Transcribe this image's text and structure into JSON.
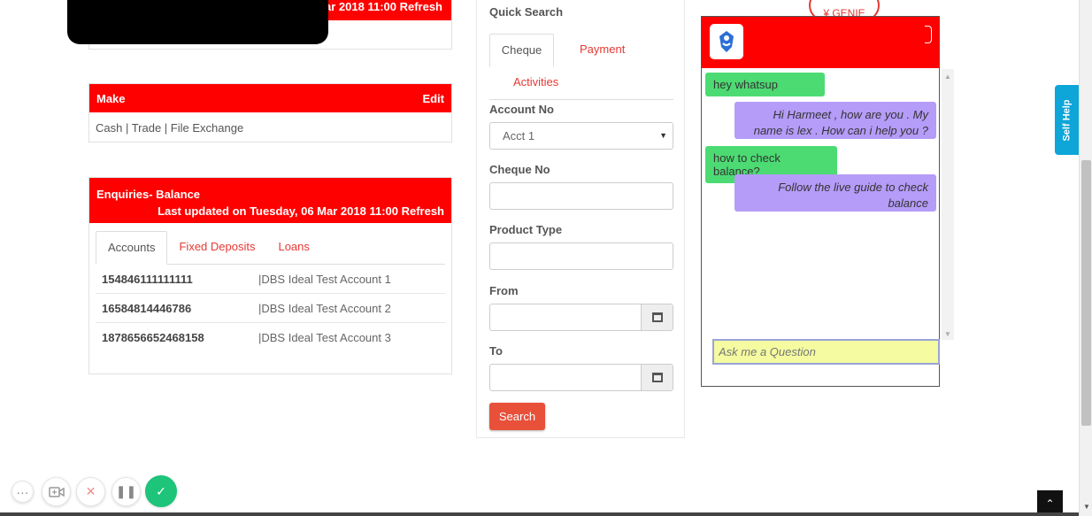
{
  "top_panel": {
    "header_text": "ar 2018 11:00 Refresh"
  },
  "make": {
    "title": "Make",
    "edit_label": "Edit",
    "body": "Cash | Trade | File Exchange"
  },
  "enquiries": {
    "title": "Enquiries- Balance",
    "subtitle": "Last updated on Tuesday, 06 Mar 2018 11:00 Refresh",
    "tabs": [
      "Accounts",
      "Fixed Deposits",
      "Loans"
    ],
    "accounts": [
      {
        "number": "154846111111111",
        "name": "|DBS Ideal Test Account 1"
      },
      {
        "number": "16584814446786",
        "name": "|DBS Ideal Test Account 2"
      },
      {
        "number": "1878656652468158",
        "name": "|DBS Ideal Test Account 3"
      }
    ]
  },
  "quick_search": {
    "title": "Quick Search",
    "tabs": [
      "Cheque",
      "Payment",
      "Activities"
    ],
    "account_label": "Account No",
    "account_value": "Acct 1",
    "cheque_label": "Cheque No",
    "product_label": "Product Type",
    "from_label": "From",
    "to_label": "To",
    "search_label": "Search"
  },
  "chat": {
    "genie_label": "¥ GENIE",
    "messages": [
      {
        "from": "user",
        "text": "hey whatsup"
      },
      {
        "from": "bot",
        "text": "Hi Harmeet , how are you . My name is lex . How can i help you ?"
      },
      {
        "from": "user",
        "text": "how to check balance?"
      },
      {
        "from": "bot",
        "text": "Follow the live guide to check balance"
      }
    ],
    "input_placeholder": "Ask me a Question"
  },
  "self_help_label": "Self Help",
  "colors": {
    "brand_red": "#ff0000",
    "user_bubble": "#4cdb72",
    "bot_bubble": "#b49cf8",
    "self_help": "#0ea5d8",
    "search_button": "#e8503a"
  },
  "icons": {
    "calendar": "calendar-icon",
    "bot_avatar": "bot-avatar-icon",
    "scroll_top": "chevron-up-icon"
  }
}
